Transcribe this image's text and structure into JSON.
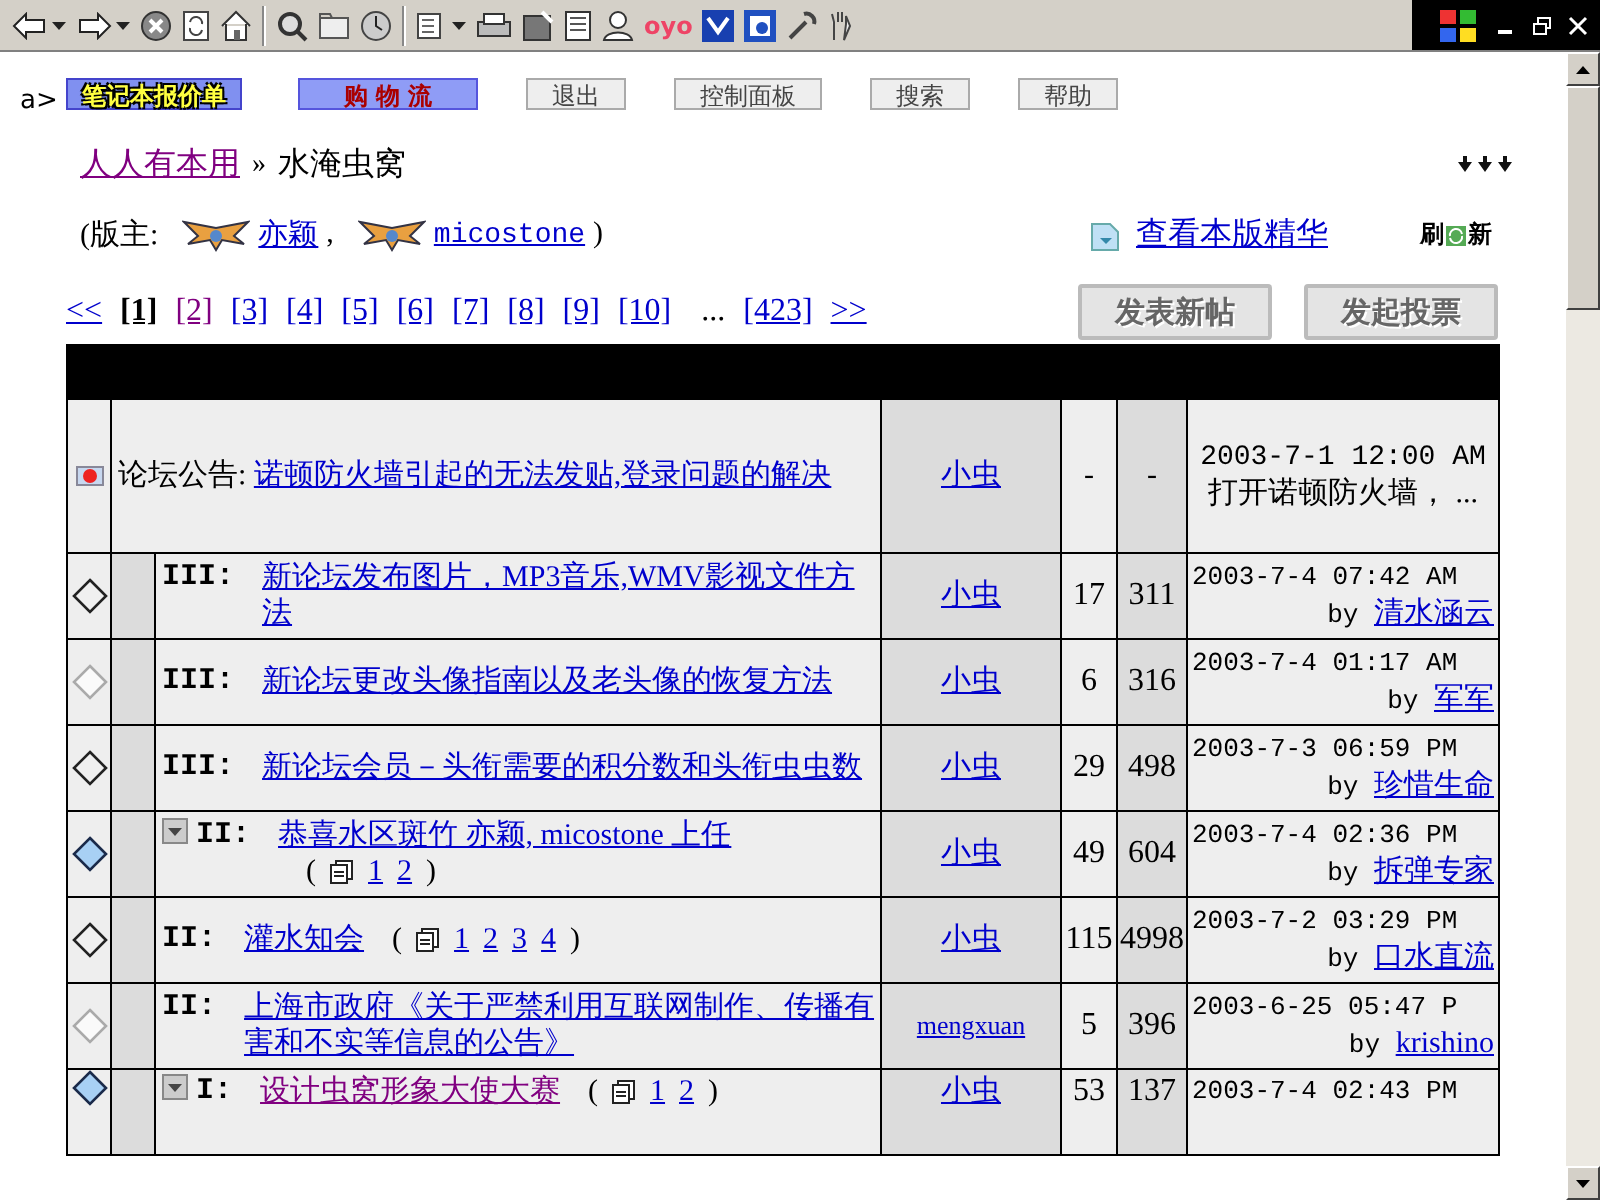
{
  "browser_toolbar": {
    "logo_text": "oyo"
  },
  "nav": {
    "prefix": "a>",
    "buttons": [
      {
        "label": "笔记本报价单",
        "kind": "yellow"
      },
      {
        "label": "购 物 流",
        "kind": "red"
      },
      {
        "label": "退出",
        "kind": "plain"
      },
      {
        "label": "控制面板",
        "kind": "plain"
      },
      {
        "label": "搜索",
        "kind": "plain"
      },
      {
        "label": "帮助",
        "kind": "plain"
      }
    ]
  },
  "breadcrumb": {
    "parent": "人人有本用",
    "separator": "»",
    "current": "水淹虫窝"
  },
  "moderators": {
    "prefix": "(版主:",
    "names": [
      "亦颖",
      "micostone"
    ],
    "separator": ",",
    "suffix": ")"
  },
  "essence_link": "查看本版精华",
  "refresh": [
    "刷",
    "新"
  ],
  "pagination": {
    "first": "<<",
    "pages": [
      {
        "label": "[1]",
        "selected": true,
        "visited": false
      },
      {
        "label": "[2]",
        "selected": false,
        "visited": true
      },
      {
        "label": "[3]",
        "selected": false,
        "visited": false
      },
      {
        "label": "[4]",
        "selected": false,
        "visited": false
      },
      {
        "label": "[5]",
        "selected": false,
        "visited": false
      },
      {
        "label": "[6]",
        "selected": false,
        "visited": false
      },
      {
        "label": "[7]",
        "selected": false,
        "visited": false
      },
      {
        "label": "[8]",
        "selected": false,
        "visited": false
      },
      {
        "label": "[9]",
        "selected": false,
        "visited": false
      },
      {
        "label": "[10]",
        "selected": false,
        "visited": false
      }
    ],
    "ellipsis": "...",
    "last_page": "[423]",
    "next": ">>"
  },
  "actions": [
    "发表新帖",
    "发起投票"
  ],
  "announcement": {
    "prefix": "论坛公告:",
    "title": "诺顿防火墙引起的无法发贴,登录问题的解决",
    "author": "小虫",
    "replies": "-",
    "views": "-",
    "last_time": "2003-7-1 12:00 AM",
    "last_note": "打开诺顿防火墙，  ..."
  },
  "topics": [
    {
      "kind": "normal",
      "collapsible": false,
      "level": "III:",
      "title": "新论坛发布图片，MP3音乐,WMV影视文件方法",
      "visited": false,
      "author": "小虫",
      "replies": "17",
      "views": "311",
      "last_time": "2003-7-4 07:42 AM",
      "by_label": "by",
      "last_by": "清水涵云"
    },
    {
      "kind": "light",
      "collapsible": false,
      "level": "III:",
      "title": "新论坛更改头像指南以及老头像的恢复方法",
      "visited": false,
      "author": "小虫",
      "replies": "6",
      "views": "316",
      "last_time": "2003-7-4 01:17 AM",
      "by_label": "by",
      "last_by": "军军"
    },
    {
      "kind": "normal",
      "collapsible": false,
      "level": "III:",
      "title": "新论坛会员－头衔需要的积分数和头衔虫虫数",
      "visited": false,
      "author": "小虫",
      "replies": "29",
      "views": "498",
      "last_time": "2003-7-3 06:59 PM",
      "by_label": "by",
      "last_by": "珍惜生命"
    },
    {
      "kind": "hot",
      "collapsible": true,
      "level": "II:",
      "title": "恭喜水区斑竹 亦颖, micostone 上任",
      "visited": false,
      "pages": {
        "open": "(",
        "numbers": [
          "1",
          "2"
        ],
        "close": ")"
      },
      "author": "小虫",
      "replies": "49",
      "views": "604",
      "last_time": "2003-7-4 02:36 PM",
      "by_label": "by",
      "last_by": "拆弹专家"
    },
    {
      "kind": "normal",
      "collapsible": false,
      "level": "II:",
      "title": "灌水知会",
      "visited": false,
      "pages": {
        "open": "(",
        "numbers": [
          "1",
          "2",
          "3",
          "4"
        ],
        "close": ")"
      },
      "author": "小虫",
      "replies": "115",
      "views": "4998",
      "last_time": "2003-7-2 03:29 PM",
      "by_label": "by",
      "last_by": "口水直流"
    },
    {
      "kind": "light",
      "collapsible": false,
      "level": "II:",
      "title": "上海市政府《关于严禁利用互联网制作、传播有害和不实等信息的公告》",
      "visited": false,
      "author": "mengxuan",
      "replies": "5",
      "views": "396",
      "last_time": "2003-6-25 05:47 P",
      "by_label": "by",
      "last_by": "krishino"
    },
    {
      "kind": "hot",
      "collapsible": true,
      "level": "I:",
      "title": "设计虫窝形象大使大赛",
      "visited": true,
      "pages": {
        "open": "(",
        "numbers": [
          "1",
          "2"
        ],
        "close": ")"
      },
      "author": "小虫",
      "replies": "53",
      "views": "137",
      "last_time": "2003-7-4 02:43 PM"
    }
  ]
}
